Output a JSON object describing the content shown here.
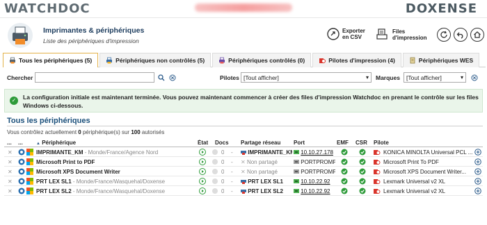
{
  "brand": {
    "left_logo": "WATCHDOC",
    "right_logo": "DOXENSE"
  },
  "header": {
    "title": "Imprimantes & périphériques",
    "subtitle": "Liste des périphériques d'impression",
    "export_csv": "Exporter en CSV",
    "print_queues": "Files d'impression"
  },
  "tabs": [
    {
      "label": "Tous les périphériques (5)",
      "active": true,
      "icon": "printer-icon"
    },
    {
      "label": "Périphériques non contrôlés (5)",
      "active": false,
      "icon": "printer-icon"
    },
    {
      "label": "Périphériques contrôlés (0)",
      "active": false,
      "icon": "printer-icon"
    },
    {
      "label": "Pilotes d'impression (4)",
      "active": false,
      "icon": "driver-icon"
    },
    {
      "label": "Périphériques WES",
      "active": false,
      "icon": "wes-icon"
    }
  ],
  "filters": {
    "search_label": "Chercher",
    "search_value": "",
    "drivers_label": "Pilotes",
    "drivers_value": "[Tout afficher]",
    "brands_label": "Marques",
    "brands_value": "[Tout afficher]"
  },
  "notice": "La configuration initiale est maintenant terminée. Vous pouvez maintenant commencer à créer des files d'impression Watchdoc en prenant le contrôle sur les files Windows ci-dessous.",
  "section": {
    "title": "Tous les périphériques",
    "quota_prefix": "Vous contrôlez actuellement ",
    "quota_count": "0",
    "quota_mid": " périphérique(s) sur ",
    "quota_max": "100",
    "quota_suffix": " autorisés"
  },
  "columns": {
    "c1": "...",
    "c2": "...",
    "device": "Périphérique",
    "state": "État",
    "docs": "Docs",
    "share": "Partage réseau",
    "port": "Port",
    "emf": "EMF",
    "csr": "CSR",
    "driver": "Pilote"
  },
  "rows": [
    {
      "name": "IMPRIMANTE_KM",
      "path": " - Monde/France/Agence Nord",
      "docs": "0",
      "share": "IMPRIMANTE_KM",
      "shared": true,
      "port": "10.10.27.178",
      "port_link": true,
      "driver": "KONICA MINOLTA Universal PCL ..."
    },
    {
      "name": "Microsoft Print to PDF",
      "path": "",
      "docs": "0",
      "share": "Non partagé",
      "shared": false,
      "port": "PORTPROMPT:",
      "port_link": false,
      "driver": "Microsoft Print To PDF"
    },
    {
      "name": "Microsoft XPS Document Writer",
      "path": "",
      "docs": "0",
      "share": "Non partagé",
      "shared": false,
      "port": "PORTPROMPT:",
      "port_link": false,
      "driver": "Microsoft XPS Document Writer..."
    },
    {
      "name": "PRT LEX SL1",
      "path": " - Monde/France/Wasquehal/Doxense",
      "docs": "0",
      "share": "PRT LEX SL1",
      "shared": true,
      "port": "10.10.22.92",
      "port_link": true,
      "driver": "Lexmark Universal v2 XL"
    },
    {
      "name": "PRT LEX SL2",
      "path": " - Monde/France/Wasquehal/Doxense",
      "docs": "0",
      "share": "PRT LEX SL2",
      "shared": true,
      "port": "10.10.22.92",
      "port_link": true,
      "driver": "Lexmark Universal v2 XL"
    }
  ],
  "colors": {
    "accent": "#1a4f7a",
    "ok_green": "#2e9b3a",
    "tab_active_border": "#e3b24a"
  }
}
